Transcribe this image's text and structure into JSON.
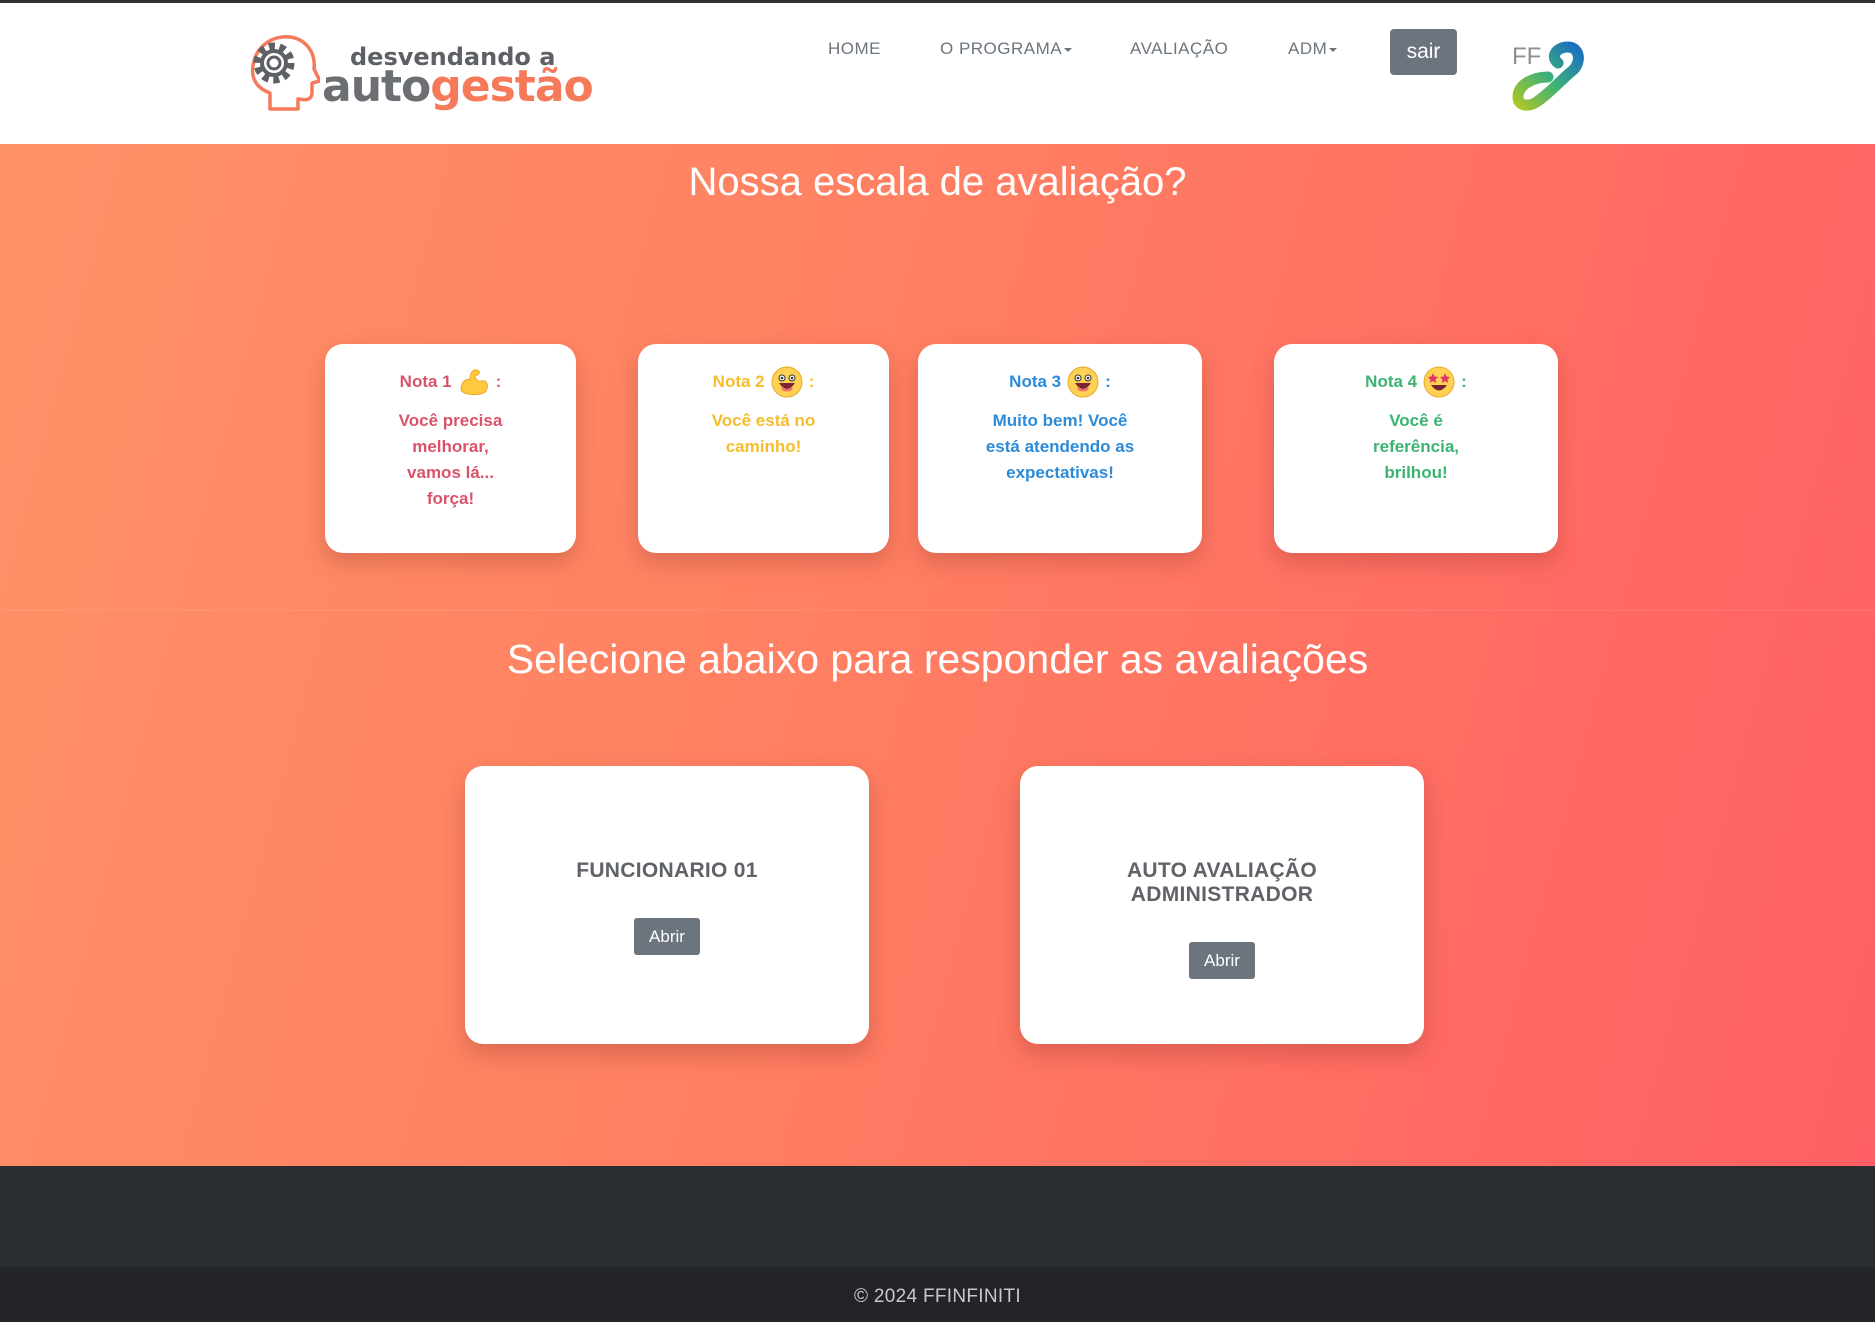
{
  "header": {
    "logo": {
      "small_text": "desvendando a",
      "auto": "auto",
      "gestao": "gestão"
    },
    "nav": {
      "home": "HOME",
      "programa": "O PROGRAMA",
      "avaliacao": "AVALIAÇÃO",
      "adm": "ADM"
    },
    "sair_label": "sair",
    "partner_logo_text": "FF"
  },
  "scale": {
    "title": "Nossa escala de avaliação?",
    "cards": [
      {
        "label": "Nota 1",
        "emoji": "flexed-biceps-icon",
        "colon": ":",
        "text": "Você precisa melhorar, vamos lá... força!",
        "color": "#d9546b"
      },
      {
        "label": "Nota 2",
        "emoji": "grinning-face-icon",
        "colon": ":",
        "text": "Você está no caminho!",
        "color": "#f5bd2c"
      },
      {
        "label": "Nota 3",
        "emoji": "grinning-face-icon",
        "colon": ":",
        "text": "Muito bem! Você está atendendo as expectativas!",
        "color": "#2c8bd8"
      },
      {
        "label": "Nota 4",
        "emoji": "star-struck-icon",
        "colon": ":",
        "text": "Você é referência, brilhou!",
        "color": "#3cb371"
      }
    ]
  },
  "evaluations": {
    "title": "Selecione abaixo para responder as avaliações",
    "cards": [
      {
        "title": "FUNCIONARIO 01",
        "button": "Abrir"
      },
      {
        "title": "AUTO AVALIAÇÃO ADMINISTRADOR",
        "button": "Abrir"
      }
    ]
  },
  "footer": {
    "copyright": "© 2024 FFINFINITI"
  },
  "colors": {
    "accent_gradient_start": "#ff9166",
    "accent_gradient_end": "#ff5f64",
    "button_gray": "#6c757d",
    "footer_dark": "#2b2e31"
  }
}
